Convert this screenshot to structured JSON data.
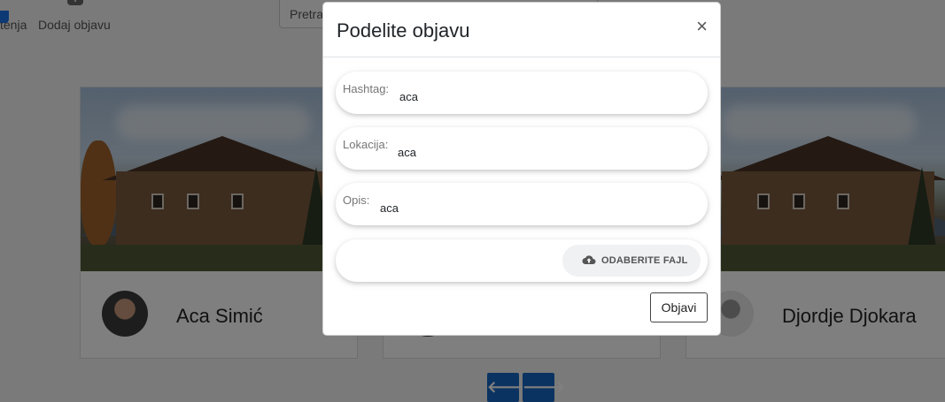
{
  "nav": {
    "partial_label": "tenja",
    "add_post_label": "Dodaj objavu"
  },
  "search": {
    "placeholder": "Pretra"
  },
  "cards": [
    {
      "name": "Aca Simić"
    },
    {
      "name": ""
    },
    {
      "name": "Djordje Djokara"
    }
  ],
  "pager": {
    "prev": "🡐",
    "next": "🡒"
  },
  "modal": {
    "title": "Podelite objavu",
    "close": "×",
    "fields": {
      "hashtag": {
        "label": "Hashtag:",
        "value": "aca"
      },
      "location": {
        "label": "Lokacija:",
        "value": "aca"
      },
      "description": {
        "label": "Opis:",
        "value": "aca"
      }
    },
    "file_button": "ODABERITE FAJL",
    "submit": "Objavi"
  },
  "colors": {
    "pager_blue": "#1766c2",
    "backdrop": "rgba(0,0,0,0.5)"
  }
}
